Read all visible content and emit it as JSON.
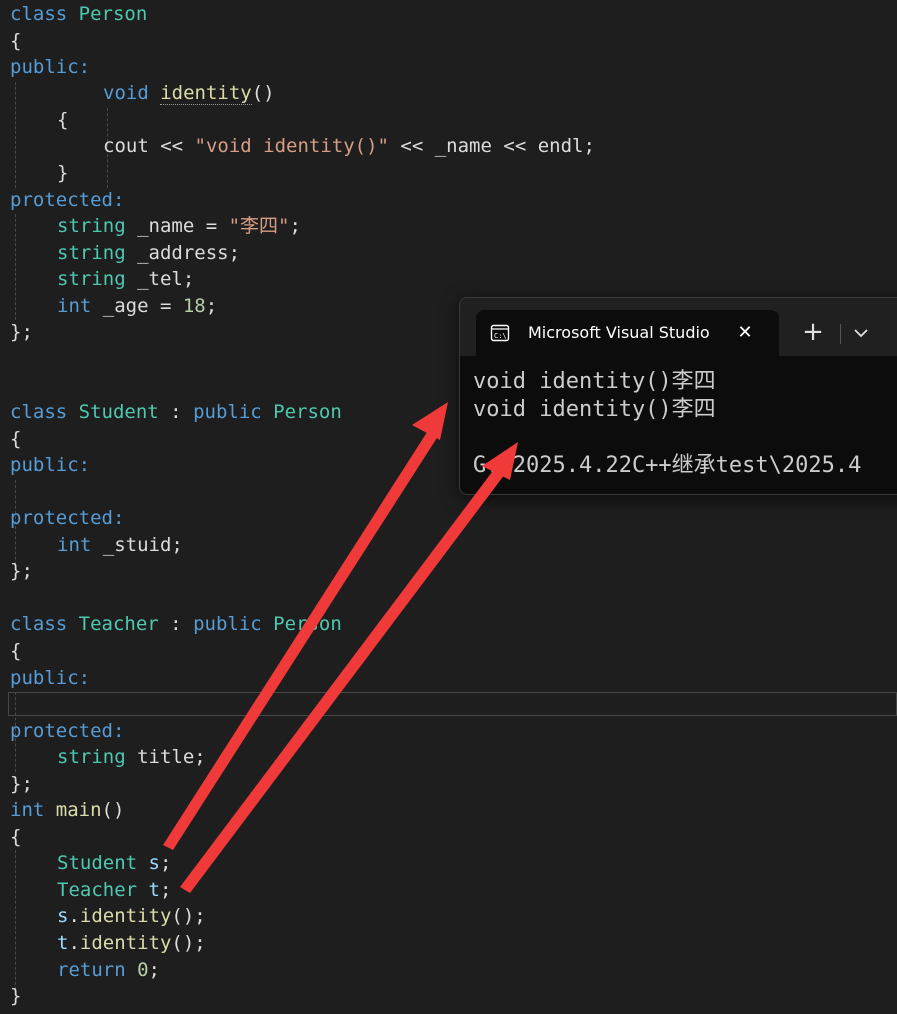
{
  "code": {
    "l1": {
      "kw": "class",
      "ty": "Person"
    },
    "l2": "{",
    "l3": "public:",
    "l4": {
      "kw": "void",
      "fn": "identity",
      "rest": "()"
    },
    "l5": "{",
    "l6": {
      "pre": "cout << ",
      "str": "\"void identity()\"",
      "post": " << _name << endl;"
    },
    "l7": "}",
    "l8": "protected:",
    "l9": {
      "ty": "string",
      "mid": " _name = ",
      "str": "\"李四\"",
      "end": ";"
    },
    "l10": {
      "ty": "string",
      "rest": " _address;"
    },
    "l11": {
      "ty": "string",
      "rest": " _tel;"
    },
    "l12": {
      "kw": "int",
      "mid": " _age = ",
      "num": "18",
      "end": ";"
    },
    "l13": "};",
    "l14": {
      "kw": "class",
      "ty": "Student",
      "colon": " : ",
      "kw2": "public",
      "ty2": "Person"
    },
    "l15": "{",
    "l16": "public:",
    "l17": "protected:",
    "l18": {
      "kw": "int",
      "rest": " _stuid;"
    },
    "l19": "};",
    "l20": {
      "kw": "class",
      "ty": "Teacher",
      "colon": " : ",
      "kw2": "public",
      "ty2": "Person"
    },
    "l21": "{",
    "l22": "public:",
    "l23": "protected:",
    "l24": {
      "ty": "string",
      "rest": " title;"
    },
    "l25": "};",
    "l26": {
      "kw": "int",
      "fn": "main",
      "rest": "()"
    },
    "l27": "{",
    "l28": {
      "ty": "Student",
      "var": "s",
      "end": ";"
    },
    "l29": {
      "ty": "Teacher",
      "var": "t",
      "end": ";"
    },
    "l30": {
      "var": "s",
      "dot": ".",
      "fn": "identity",
      "end": "();"
    },
    "l31": {
      "var": "t",
      "dot": ".",
      "fn": "identity",
      "end": "();"
    },
    "l32": {
      "kw": "return",
      "num": "0",
      "end": ";"
    },
    "l33": "}"
  },
  "terminal": {
    "tab_title": "Microsoft Visual Studio",
    "close_glyph": "✕",
    "new_tab_glyph": "+",
    "output": [
      "void identity()李四",
      "void identity()李四",
      "",
      "G:\\2025.4.22C++继承test\\2025.4"
    ]
  },
  "colors": {
    "background": "#1e1e1e",
    "keyword": "#569cd6",
    "type": "#4ec9b0",
    "function": "#dcdcaa",
    "string": "#d69d85",
    "number": "#b5cea8",
    "arrow": "#f03a3a"
  }
}
